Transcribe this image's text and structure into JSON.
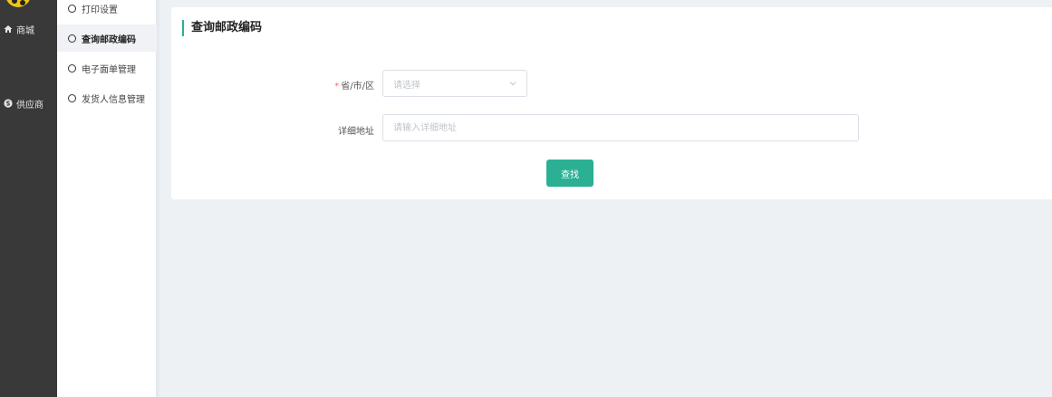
{
  "nav": {
    "items": [
      {
        "label": "商城",
        "icon": "home-icon"
      },
      {
        "label": "供应商",
        "icon": "supplier-icon"
      }
    ]
  },
  "sidebar": {
    "items": [
      {
        "label": "打印设置",
        "active": false
      },
      {
        "label": "查询邮政编码",
        "active": true
      },
      {
        "label": "电子面单管理",
        "active": false
      },
      {
        "label": "发货人信息管理",
        "active": false
      }
    ]
  },
  "main": {
    "title": "查询邮政编码",
    "region_label_required": "*",
    "region_label": "省/市/区",
    "region_placeholder": "请选择",
    "address_label": "详细地址",
    "address_placeholder": "请输入详细地址",
    "search_button": "查找"
  },
  "colors": {
    "accent": "#2bb094",
    "nav_bg": "#393939",
    "page_bg": "#eef1f4",
    "required": "#f56c6c"
  }
}
